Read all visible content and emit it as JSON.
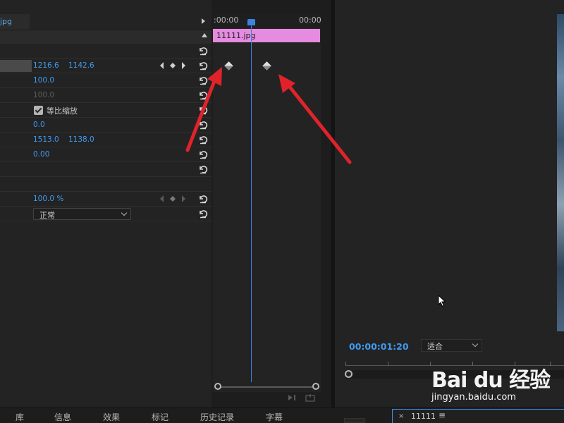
{
  "effect_controls": {
    "clip_tab": "jpg",
    "rows": [
      {
        "v1": "1216.6",
        "v2": "1142.6"
      },
      {
        "v1": "100.0"
      },
      {
        "v1": "100.0"
      },
      {
        "uniform_scale_label": "等比缩放"
      },
      {
        "v1": "0.0"
      },
      {
        "v1": "1513.0",
        "v2": "1138.0"
      },
      {
        "v1": "0.00"
      },
      {
        "opacity": "100.0 %"
      },
      {
        "blend_mode": "正常"
      }
    ]
  },
  "timeline": {
    "start_time": ":00:00",
    "end_time": "00:00",
    "clip_name": "11111.jpg",
    "clip_color": "#e58be0"
  },
  "monitor": {
    "timecode": "00:00:01:20",
    "fit": "适合"
  },
  "bottom_tabs": [
    "库",
    "信息",
    "效果",
    "标记",
    "历史记录",
    "字幕"
  ],
  "sequence_tab": {
    "close": "×",
    "name": "11111",
    "menu": "≡"
  },
  "watermark": {
    "logo": "Bai du 经验",
    "url": "jingyan.baidu.com"
  },
  "colors": {
    "accent_blue": "#3e9bf0",
    "annotation_red": "#e0232a"
  }
}
